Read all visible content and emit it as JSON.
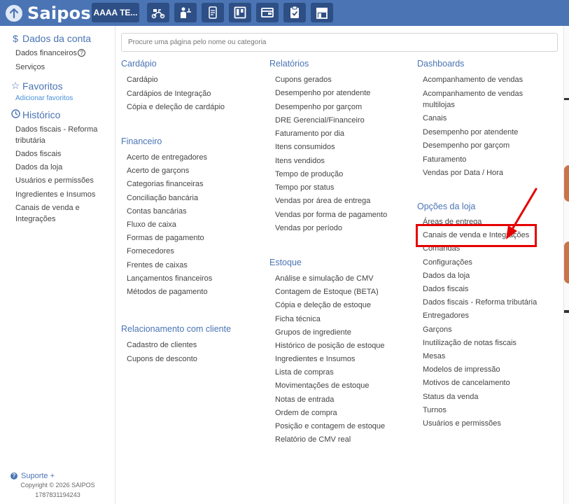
{
  "topbar": {
    "logo_text": "Saipos",
    "store_label": "AAAA TE..."
  },
  "search": {
    "placeholder": "Procure uma página pelo nome ou categoria"
  },
  "sidebar": {
    "account": {
      "title": "Dados da conta",
      "items": [
        "Dados financeiros",
        "Serviços"
      ]
    },
    "favorites": {
      "title": "Favoritos",
      "add_link": "Adicionar favoritos"
    },
    "history": {
      "title": "Histórico",
      "items": [
        "Dados fiscais - Reforma tributária",
        "Dados fiscais",
        "Dados da loja",
        "Usuários e permissões",
        "Ingredientes e Insumos",
        "Canais de venda e Integrações"
      ]
    },
    "support_label": "Suporte +",
    "copyright": "Copyright © 2026 SAIPOS",
    "build": "1787831194243"
  },
  "columns": {
    "cardapio": {
      "title": "Cardápio",
      "items": [
        "Cardápio",
        "Cardápios de Integração",
        "Cópia e deleção de cardápio"
      ]
    },
    "financeiro": {
      "title": "Financeiro",
      "items": [
        "Acerto de entregadores",
        "Acerto de garçons",
        "Categorias financeiras",
        "Conciliação bancária",
        "Contas bancárias",
        "Fluxo de caixa",
        "Formas de pagamento",
        "Fornecedores",
        "Frentes de caixas",
        "Lançamentos financeiros",
        "Métodos de pagamento"
      ]
    },
    "relacionamento": {
      "title": "Relacionamento com cliente",
      "items": [
        "Cadastro de clientes",
        "Cupons de desconto"
      ]
    },
    "relatorios": {
      "title": "Relatórios",
      "items": [
        "Cupons gerados",
        "Desempenho por atendente",
        "Desempenho por garçom",
        "DRE Gerencial/Financeiro",
        "Faturamento por dia",
        "Itens consumidos",
        "Itens vendidos",
        "Tempo de produção",
        "Tempo por status",
        "Vendas por área de entrega",
        "Vendas por forma de pagamento",
        "Vendas por período"
      ]
    },
    "estoque": {
      "title": "Estoque",
      "items": [
        "Análise e simulação de CMV",
        "Contagem de Estoque (BETA)",
        "Cópia e deleção de estoque",
        "Ficha técnica",
        "Grupos de ingrediente",
        "Histórico de posição de estoque",
        "Ingredientes e Insumos",
        "Lista de compras",
        "Movimentações de estoque",
        "Notas de entrada",
        "Ordem de compra",
        "Posição e contagem de estoque",
        "Relatório de CMV real"
      ]
    },
    "dashboards": {
      "title": "Dashboards",
      "items": [
        "Acompanhamento de vendas",
        "Acompanhamento de vendas multilojas",
        "Canais",
        "Desempenho por atendente",
        "Desempenho por garçom",
        "Faturamento",
        "Vendas por Data / Hora"
      ]
    },
    "opcoes": {
      "title": "Opções da loja",
      "items": [
        "Áreas de entrega",
        "Canais de venda e Integrações",
        "Comandas",
        "Configurações",
        "Dados da loja",
        "Dados fiscais",
        "Dados fiscais - Reforma tributária",
        "Entregadores",
        "Garçons",
        "Inutilização de notas fiscais",
        "Mesas",
        "Modelos de impressão",
        "Motivos de cancelamento",
        "Status da venda",
        "Turnos",
        "Usuários e permissões"
      ]
    }
  },
  "annotation_color": "#e60000",
  "accent_color": "#4a74b4"
}
